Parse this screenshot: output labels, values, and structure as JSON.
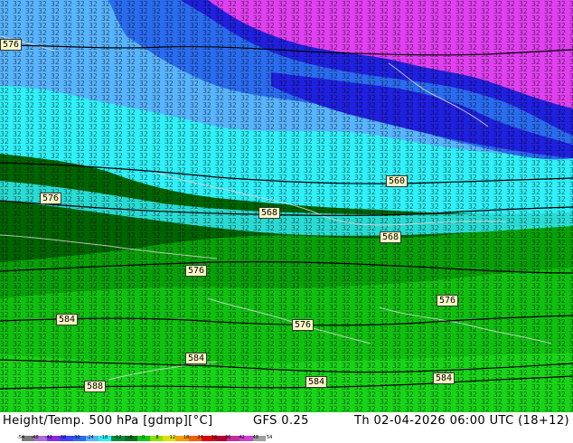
{
  "map": {
    "contour_labels": [
      "560",
      "568",
      "576",
      "576",
      "568",
      "576",
      "576",
      "584",
      "576",
      "584",
      "588",
      "584",
      "584"
    ],
    "field_colors": {
      "magenta": "#e040f0",
      "blue": "#2020e0",
      "mid_blue": "#2a6cf0",
      "light_blue": "#58b4ff",
      "cyan": "#30f0f8",
      "dark_green": "#006400",
      "green": "#08a008",
      "bright_green": "#10c010",
      "light_green": "#18d418"
    }
  },
  "footer": {
    "title": "Height/Temp. 500 hPa [gdmp][°C]",
    "model": "GFS 0.25",
    "date": "Th 02-04-2026 06:00 UTC (18+12)"
  },
  "legend": {
    "ticks": [
      "-54",
      "-48",
      "-42",
      "-38",
      "-30",
      "-24",
      "-18",
      "-12",
      "-8",
      "0",
      "8",
      "12",
      "18",
      "24",
      "30",
      "36",
      "42",
      "48",
      "54"
    ],
    "colors": [
      "#7a7a7a",
      "#b06bd6",
      "#8a2be2",
      "#4040ff",
      "#2a6cf0",
      "#58b4ff",
      "#30f0f8",
      "#0f8a3c",
      "#0b6e20",
      "#18c418",
      "#8ae000",
      "#e0e000",
      "#f0a000",
      "#f06000",
      "#e00000",
      "#b00030",
      "#c0309a",
      "#d040d0",
      "#a0a0a0"
    ]
  }
}
